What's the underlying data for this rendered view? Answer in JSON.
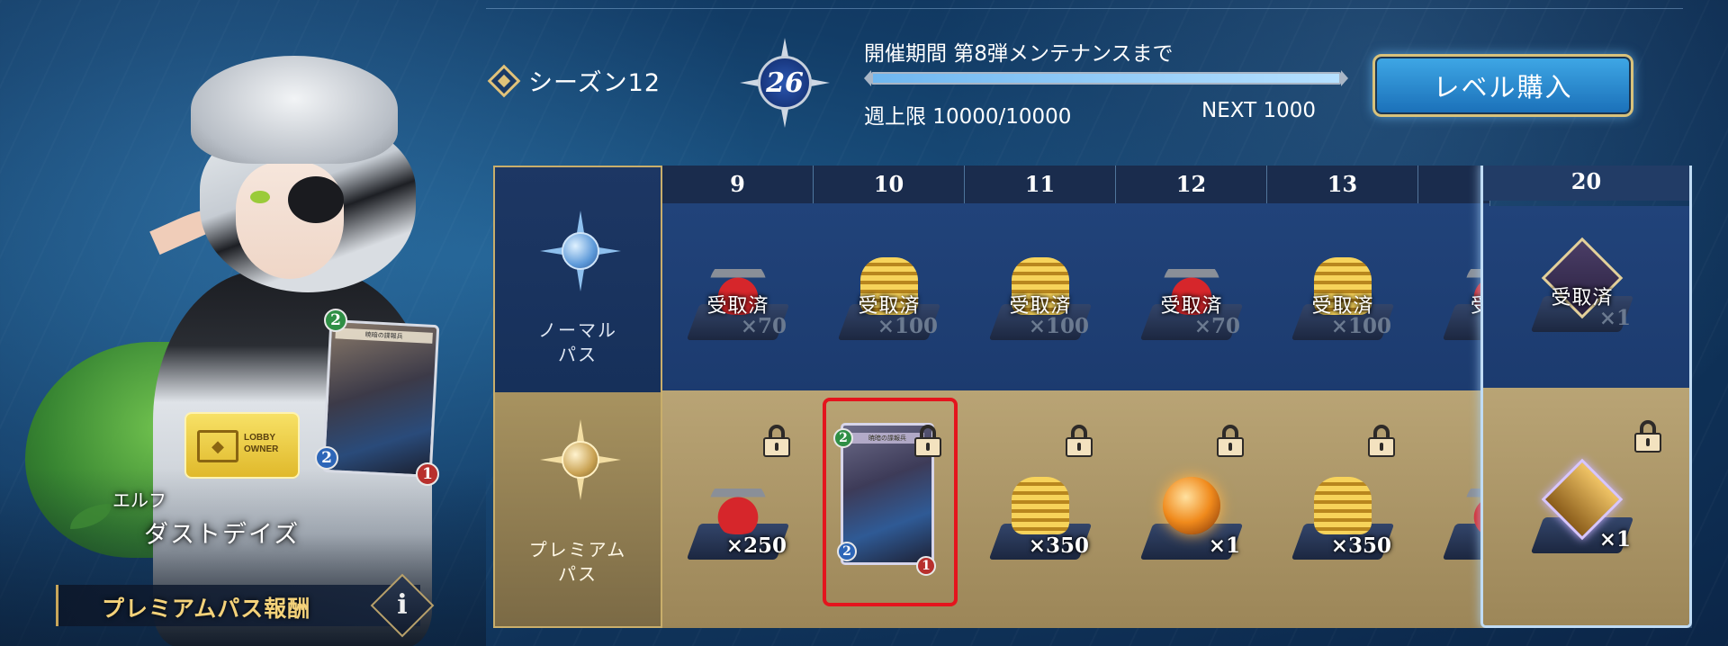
{
  "character": {
    "race": "エルフ",
    "name": "ダストデイズ",
    "lobby_badge": {
      "line1": "LOBBY",
      "line2": "OWNER"
    },
    "held_card": {
      "title": "暁暗の諜報兵",
      "cost": "2",
      "attack": "2",
      "health": "1"
    }
  },
  "premium_reward_label": "プレミアムパス報酬",
  "info_label": "i",
  "header": {
    "season": "シーズン12",
    "level": "26",
    "period": "開催期間 第8弾メンテナンスまで",
    "progress": 1.0,
    "weekly_limit": "週上限 10000/10000",
    "next": "NEXT 1000",
    "buy_button": "レベル購入"
  },
  "tracks": {
    "normal": "ノーマル\nパス",
    "premium": "プレミアム\nパス"
  },
  "claimed_label": "受取済",
  "columns": [
    {
      "level": "9",
      "normal": {
        "icon": "potion-icon",
        "qty": "×70",
        "claimed": true
      },
      "premium": {
        "icon": "potion-icon",
        "qty": "×250",
        "locked": true
      }
    },
    {
      "level": "10",
      "normal": {
        "icon": "coins-icon",
        "qty": "×100",
        "claimed": true
      },
      "premium": {
        "icon": "card-icon",
        "title": "暁暗の諜報兵",
        "cost": "2",
        "attack": "2",
        "health": "1",
        "locked": true,
        "highlighted": true
      }
    },
    {
      "level": "11",
      "normal": {
        "icon": "coins-icon",
        "qty": "×100",
        "claimed": true
      },
      "premium": {
        "icon": "coins-icon",
        "qty": "×350",
        "locked": true
      }
    },
    {
      "level": "12",
      "normal": {
        "icon": "potion-icon",
        "qty": "×70",
        "claimed": true
      },
      "premium": {
        "icon": "orb-icon",
        "qty": "×1",
        "locked": true
      }
    },
    {
      "level": "13",
      "normal": {
        "icon": "coins-icon",
        "qty": "×100",
        "claimed": true
      },
      "premium": {
        "icon": "coins-icon",
        "qty": "×350",
        "locked": true
      }
    }
  ],
  "partial_column": {
    "normal_claimed_fragment": "受",
    "premium_icon": "potion-icon"
  },
  "final_column": {
    "level": "20",
    "normal": {
      "icon": "emblem-icon",
      "qty": "×1",
      "claimed": true
    },
    "premium": {
      "icon": "chest-icon",
      "qty": "×1",
      "locked": true
    }
  },
  "colors": {
    "accent_gold": "#c9ae6b",
    "highlight_red": "#e4141d",
    "button_blue": "#2a8fd6"
  }
}
